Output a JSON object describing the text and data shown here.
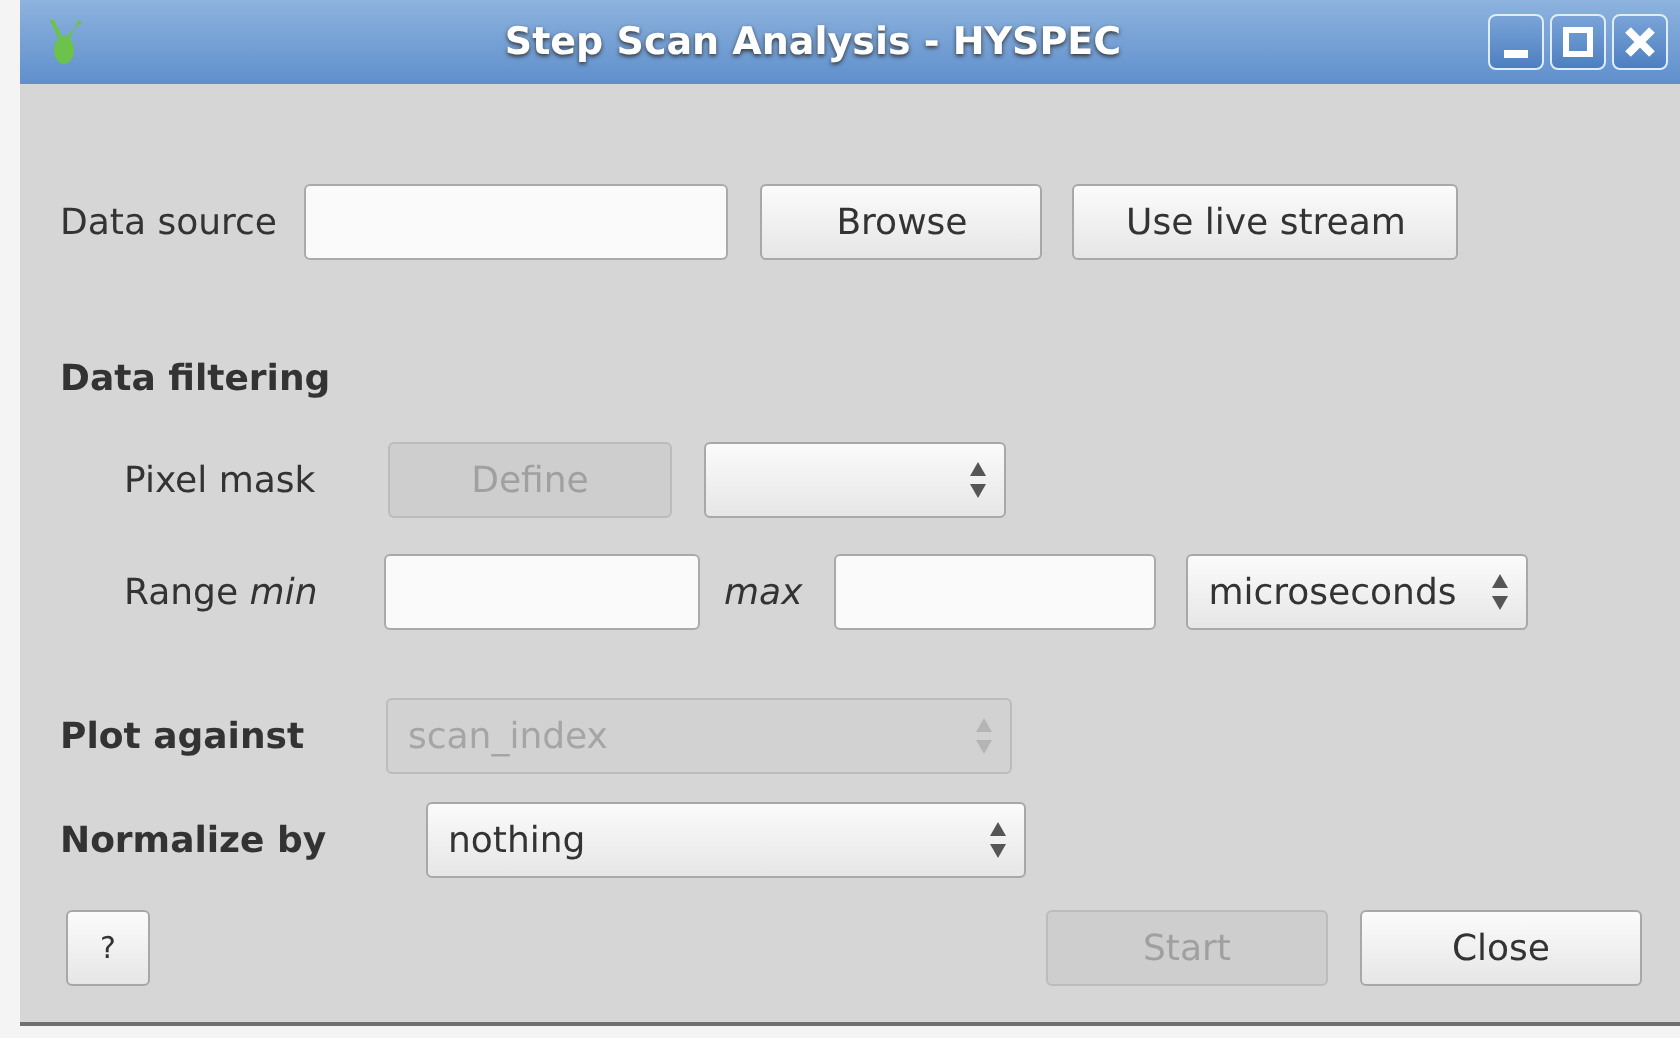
{
  "window": {
    "title": "Step Scan Analysis - HYSPEC"
  },
  "data_source": {
    "label": "Data source",
    "buttons": [
      {
        "label": "Browse",
        "disabled": false
      },
      {
        "label": "Use live stream",
        "disabled": false
      }
    ]
  },
  "data_filtering": {
    "heading": "Data filtering",
    "pixel_mask": {
      "label": "Pixel mask",
      "button": {
        "label": "Define",
        "disabled": true
      },
      "select": {
        "disabled": false
      }
    },
    "range": {
      "label": "Range *min*",
      "max_label": "max",
      "unit": {
        "value": "microseconds",
        "disabled": false
      }
    }
  },
  "plot_against": {
    "label": "Plot against",
    "value": "scan_index",
    "disabled": true
  },
  "normalize_by": {
    "label": "Normalize by",
    "value": "nothing",
    "disabled": false
  },
  "footer": {
    "help": {
      "label": "?",
      "disabled": false
    },
    "buttons": [
      {
        "label": "Start",
        "disabled": true
      },
      {
        "label": "Close",
        "disabled": false
      }
    ]
  }
}
